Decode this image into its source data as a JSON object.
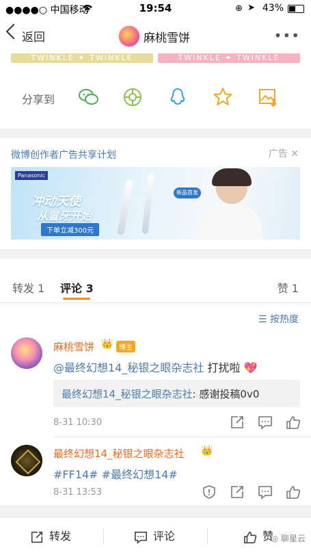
{
  "status_bar": {
    "carrier": "●●●●○ 中国移动",
    "time": "19:54",
    "battery": "43%"
  },
  "nav": {
    "back_label": "返回",
    "title": "麻桃雪饼"
  },
  "share": {
    "banner_text": "TWINKLE ✦ TWINKLE",
    "label": "分享到"
  },
  "ad": {
    "title": "微博创作者广告共享计划",
    "tag": "广告",
    "brand": "Panasonic",
    "headline_line1": "冲动天使",
    "headline_line2": "从冒牙开始",
    "promo": "下单立减300元",
    "badge": "新品首发"
  },
  "tabs": {
    "repost": "转发 1",
    "comment": "评论 3",
    "like": "赞 1"
  },
  "sort_label": "按热度",
  "comments": [
    {
      "username": "麻桃雪饼",
      "badge": "博主",
      "mention": "@最终幻想14_秘银之眼杂志社",
      "text": "打扰啦",
      "quote_user": "最终幻想14_秘银之眼杂志社",
      "quote_text": ": 感谢投稿0v0",
      "time": "8-31 10:30"
    },
    {
      "username": "最终幻想14_秘银之眼杂志社",
      "text": "#FF14# #最终幻想14#",
      "time": "8-31 13:53"
    }
  ],
  "bottom": {
    "repost": "转发",
    "comment": "评论",
    "like": "赞"
  },
  "watermark": "聊星云",
  "colors": {
    "accent": "#f08a25",
    "link": "#4a7bb3",
    "username": "#e86b1f"
  }
}
